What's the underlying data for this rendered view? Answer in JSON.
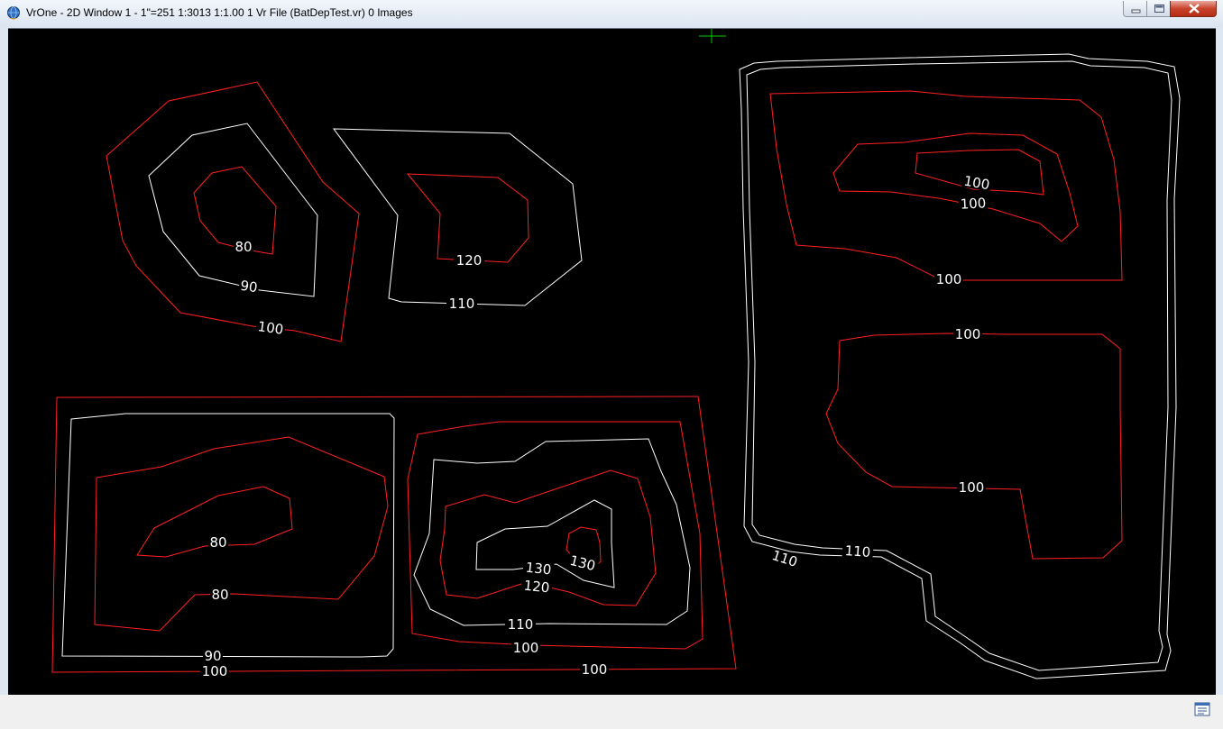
{
  "window": {
    "title": "VrOne - 2D Window 1 - 1\"=251   1:3013   1:1.00   1 Vr File  (BatDepTest.vr)   0 Images"
  },
  "icons": {
    "app": "globe-icon",
    "minimize": "minimize-icon",
    "maximize": "maximize-icon",
    "close": "close-icon",
    "status": "window-list-icon"
  },
  "colors": {
    "canvas_background": "#000000",
    "contour_red": "#ff2020",
    "contour_white": "#ffffff",
    "cursor_green": "#00cc00"
  },
  "contour_labels": {
    "label_80_a": "80",
    "label_90_a": "90",
    "label_100_a": "100",
    "label_120_a": "120",
    "label_110_a": "110",
    "label_80_b": "80",
    "label_80_c": "80",
    "label_90_b": "90",
    "label_100_b": "100",
    "label_100_c": "100",
    "label_100_d": "100",
    "label_110_b": "110",
    "label_120_b": "120",
    "label_130_a": "130",
    "label_130_b": "130",
    "label_110_c": "110",
    "label_110_d": "110",
    "label_100_e": "100",
    "label_100_f": "100",
    "label_100_g": "100",
    "label_100_h": "100",
    "label_100_i": "100"
  }
}
